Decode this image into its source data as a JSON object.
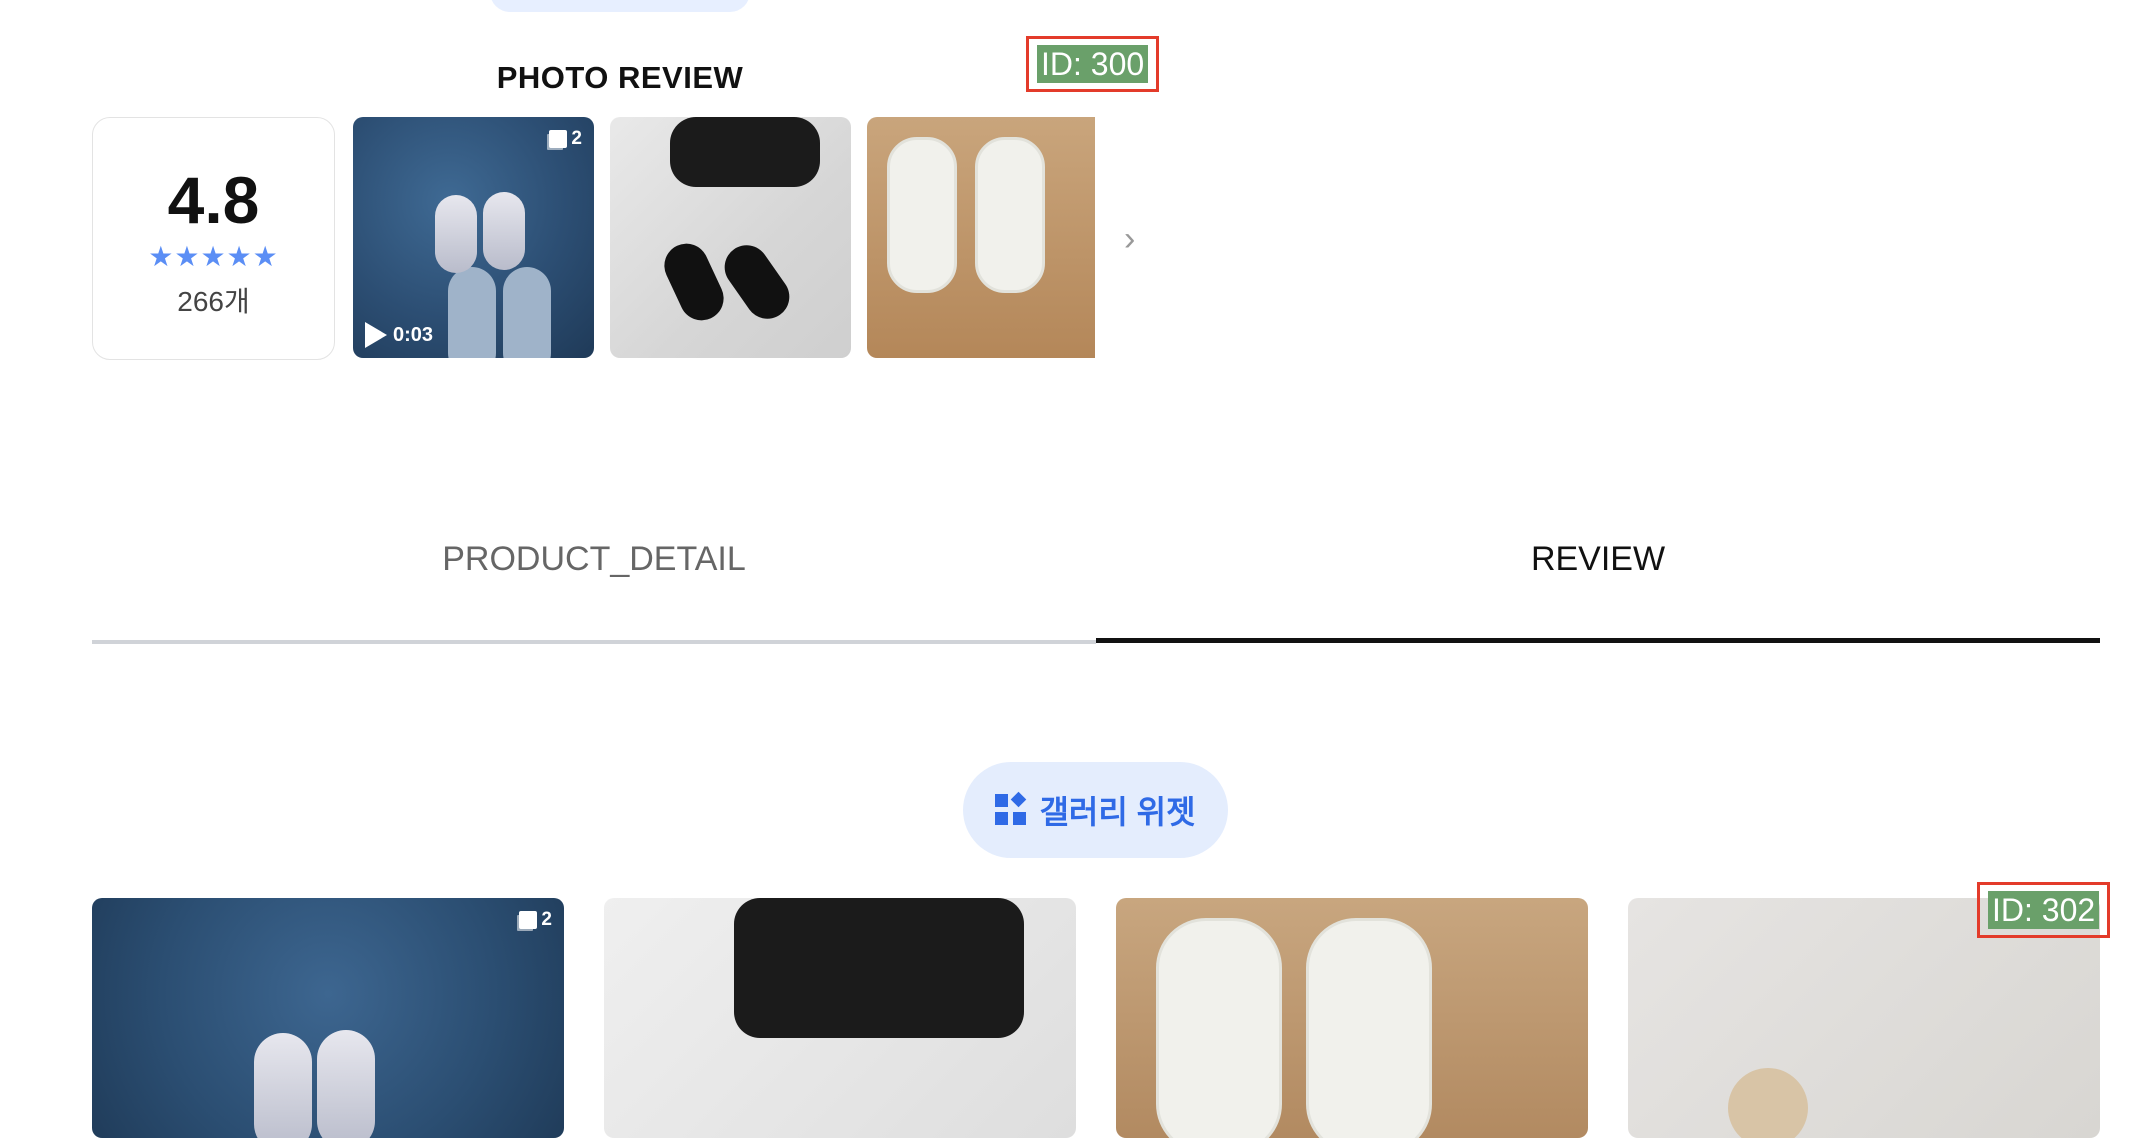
{
  "photo_review": {
    "title": "PHOTO REVIEW",
    "rating": "4.8",
    "stars": "★★★★★",
    "count": "266개",
    "thumbs": [
      {
        "multi_count": "2",
        "video_duration": "0:03"
      },
      {},
      {}
    ]
  },
  "annotations": {
    "id_top": "ID: 300",
    "id_bottom": "ID: 302"
  },
  "tabs": {
    "detail": "PRODUCT_DETAIL",
    "review": "REVIEW",
    "active": "REVIEW"
  },
  "gallery_widget": {
    "label": "갤러리 위젯"
  },
  "gallery": {
    "first_multi_count": "2"
  },
  "colors": {
    "accent": "#2f6ae6",
    "star": "#5b8ef5",
    "pill_bg": "#e4edfd",
    "annotation_border": "#e33b2a",
    "annotation_bg": "#6aa06a"
  }
}
